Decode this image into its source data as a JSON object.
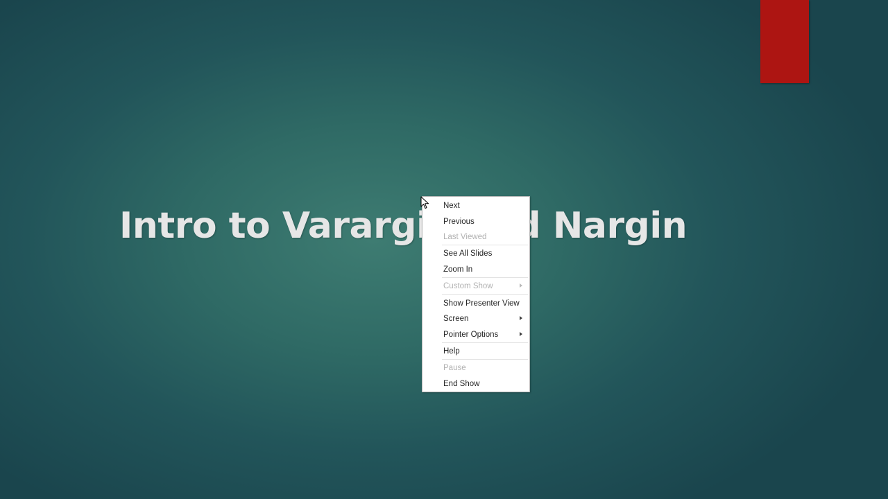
{
  "slide": {
    "title": "Intro to Varargin and Nargin",
    "accent_color": "#ad1512"
  },
  "context_menu": {
    "items": [
      {
        "label": "Next",
        "enabled": true,
        "submenu": false
      },
      {
        "label": "Previous",
        "enabled": true,
        "submenu": false
      },
      {
        "label": "Last Viewed",
        "enabled": false,
        "submenu": false
      },
      {
        "label": "See All Slides",
        "enabled": true,
        "submenu": false
      },
      {
        "label": "Zoom In",
        "enabled": true,
        "submenu": false
      },
      {
        "label": "Custom Show",
        "enabled": false,
        "submenu": true
      },
      {
        "label": "Show Presenter View",
        "enabled": true,
        "submenu": false
      },
      {
        "label": "Screen",
        "enabled": true,
        "submenu": true
      },
      {
        "label": "Pointer Options",
        "enabled": true,
        "submenu": true
      },
      {
        "label": "Help",
        "enabled": true,
        "submenu": false
      },
      {
        "label": "Pause",
        "enabled": false,
        "submenu": false
      },
      {
        "label": "End Show",
        "enabled": true,
        "submenu": false
      }
    ]
  },
  "cursor": {
    "icon": "arrow-cursor-icon"
  }
}
